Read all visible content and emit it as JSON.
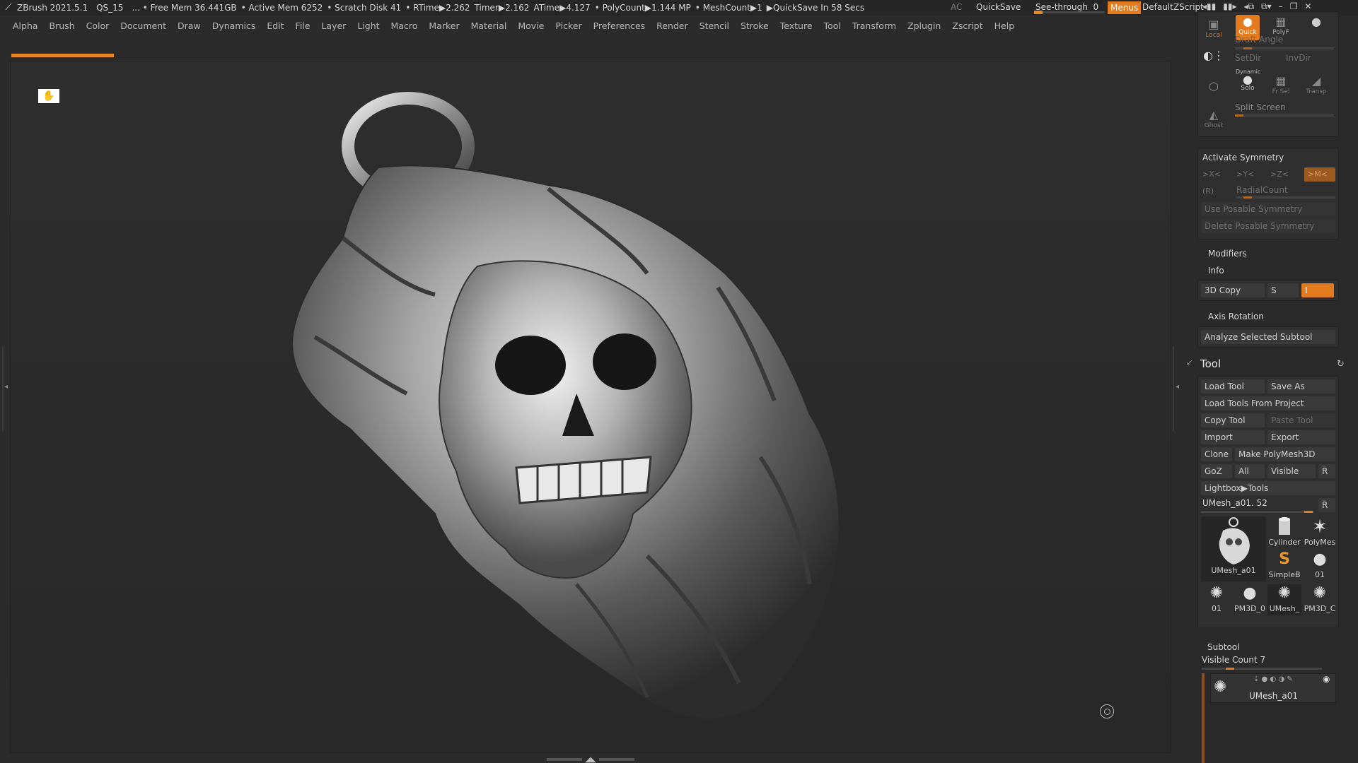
{
  "titlebar": {
    "app": "ZBrush 2021.5.1",
    "project": "QS_15",
    "free_mem": "... • Free Mem 36.441GB",
    "active_mem": "• Active Mem 6252",
    "scratch": "• Scratch Disk 41",
    "rtime": "• RTime▶2.262",
    "timer": "Timer▶2.162",
    "atime": "ATime▶4.127",
    "polycount": "• PolyCount▶1.144 MP",
    "meshcount": "• MeshCount▶1",
    "quicksave_in": "▶QuickSave In 58 Secs",
    "ac": "AC",
    "quicksave": "QuickSave",
    "see_through_label": "See-through",
    "see_through_value": "0",
    "see_through_level": 0,
    "menus": "Menus",
    "default_zscript": "DefaultZScript"
  },
  "menubar": {
    "items": [
      "Alpha",
      "Brush",
      "Color",
      "Document",
      "Draw",
      "Dynamics",
      "Edit",
      "File",
      "Layer",
      "Light",
      "Macro",
      "Marker",
      "Material",
      "Movie",
      "Picker",
      "Preferences",
      "Render",
      "Stencil",
      "Stroke",
      "Texture",
      "Tool",
      "Transform",
      "Zplugin",
      "Zscript",
      "Help"
    ]
  },
  "viewport": {
    "model_description": "UMesh_a01"
  },
  "rpanel": {
    "top_tiles": {
      "local": "Local",
      "quick": "Quick",
      "polyf": "PolyF",
      "draft_angle": "Draft Angle",
      "setdir": "SetDir",
      "invdir": "InvDir",
      "dynamic": "Dynamic",
      "solo": "Solo",
      "frsel": "Fr Sel",
      "transp": "Transp",
      "split_screen": "Split Screen",
      "ghost": "Ghost"
    },
    "symmetry": {
      "title": "Activate Symmetry",
      "x": ">X<",
      "y": ">Y<",
      "z": ">Z<",
      "m": ">M<",
      "r": "(R)",
      "radial_count": "RadialCount",
      "use_posable": "Use Posable Symmetry",
      "delete_posable": "Delete Posable Symmetry"
    },
    "modifiers": "Modifiers",
    "info": "Info",
    "copy3d": {
      "label": "3D Copy",
      "s": "S",
      "i": "I"
    },
    "axis_rotation": "Axis Rotation",
    "analyze": "Analyze Selected Subtool",
    "tool": {
      "title": "Tool",
      "load_tool": "Load Tool",
      "save_as": "Save As",
      "load_from_project": "Load Tools From Project",
      "copy_tool": "Copy Tool",
      "paste_tool": "Paste Tool",
      "import": "Import",
      "export": "Export",
      "clone": "Clone",
      "make_polymesh": "Make PolyMesh3D",
      "goz": "GoZ",
      "all": "All",
      "visible": "Visible",
      "r": "R",
      "lightbox_tools": "Lightbox▶Tools",
      "current_tool": "UMesh_a01. 52",
      "r2": "R",
      "thumbs": {
        "main": "UMesh_a01",
        "cylinder": "Cylinder",
        "polymesh": "PolyMes",
        "simpleb": "SimpleB",
        "t01": "01",
        "r01": "01",
        "pm3d0": "PM3D_0",
        "umesh": "UMesh_",
        "pm3dc": "PM3D_C"
      }
    },
    "subtool": {
      "title": "Subtool",
      "visible_count": "Visible Count 7",
      "item": "UMesh_a01"
    }
  }
}
